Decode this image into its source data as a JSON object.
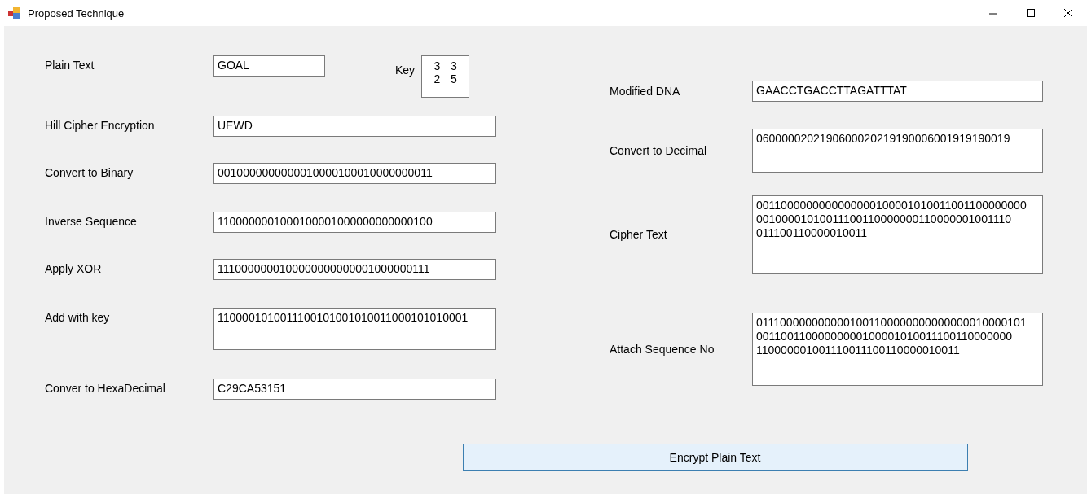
{
  "window": {
    "title": "Proposed Technique"
  },
  "left_fields": [
    {
      "label": "Plain Text",
      "lines": [
        "GOAL"
      ],
      "kind": "short"
    },
    {
      "label": "Hill Cipher Encryption",
      "lines": [
        "UEWD"
      ],
      "kind": "single"
    },
    {
      "label": "Convert to Binary",
      "lines": [
        "0010000000000010000100010000000011"
      ],
      "kind": "single"
    },
    {
      "label": "Inverse Sequence",
      "lines": [
        "1100000001000100001000000000000100"
      ],
      "kind": "single"
    },
    {
      "label": "Apply XOR",
      "lines": [
        "1110000000100000000000001000000111"
      ],
      "kind": "single"
    },
    {
      "label": "Add with key",
      "lines": [
        "1100001010011100101001010011000101010001"
      ],
      "kind": "multi"
    },
    {
      "label": "Conver to HexaDecimal",
      "lines": [
        "C29CA53151"
      ],
      "kind": "single"
    }
  ],
  "key": {
    "label": "Key",
    "matrix": [
      [
        "3",
        "3"
      ],
      [
        "2",
        "5"
      ]
    ]
  },
  "right_fields": [
    {
      "label": "Modified DNA",
      "lines": [
        "GAACCTGACCTTAGATTTAT"
      ],
      "kind": "single"
    },
    {
      "label": "Convert to Decimal",
      "lines": [
        "0600000202190600020219190006001919190019"
      ],
      "kind": "multi"
    },
    {
      "label": "Cipher Text",
      "lines": [
        "0011000000000000000100001010011001100000000",
        "00100001010011100110000000110000001001110",
        "011100110000010011"
      ],
      "kind": "multi"
    },
    {
      "label": "Attach Sequence No",
      "lines": [
        "0111000000000001001100000000000000010000101",
        "00110011000000000100001010011100110000000",
        "110000001001110011100110000010011"
      ],
      "kind": "multi"
    }
  ],
  "button": {
    "label": "Encrypt Plain Text"
  }
}
